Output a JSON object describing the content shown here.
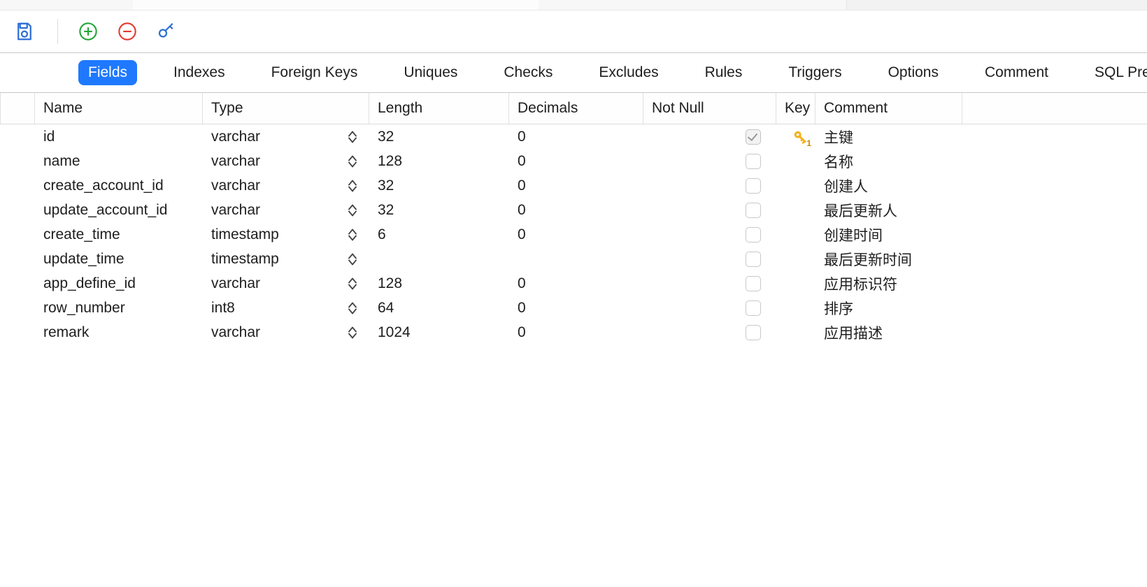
{
  "tabs": {
    "items": [
      {
        "id": "fields",
        "label": "Fields",
        "active": true
      },
      {
        "id": "indexes",
        "label": "Indexes",
        "active": false
      },
      {
        "id": "foreignkeys",
        "label": "Foreign Keys",
        "active": false
      },
      {
        "id": "uniques",
        "label": "Uniques",
        "active": false
      },
      {
        "id": "checks",
        "label": "Checks",
        "active": false
      },
      {
        "id": "excludes",
        "label": "Excludes",
        "active": false
      },
      {
        "id": "rules",
        "label": "Rules",
        "active": false
      },
      {
        "id": "triggers",
        "label": "Triggers",
        "active": false
      },
      {
        "id": "options",
        "label": "Options",
        "active": false
      },
      {
        "id": "comment",
        "label": "Comment",
        "active": false
      },
      {
        "id": "sqlpreview",
        "label": "SQL Preview",
        "active": false
      }
    ]
  },
  "headers": {
    "name": "Name",
    "type": "Type",
    "length": "Length",
    "decimals": "Decimals",
    "notnull": "Not Null",
    "key": "Key",
    "comment": "Comment"
  },
  "rows": [
    {
      "name": "id",
      "type": "varchar",
      "length": "32",
      "decimals": "0",
      "notnull": true,
      "key": true,
      "comment": "主键"
    },
    {
      "name": "name",
      "type": "varchar",
      "length": "128",
      "decimals": "0",
      "notnull": false,
      "key": false,
      "comment": "名称"
    },
    {
      "name": "create_account_id",
      "type": "varchar",
      "length": "32",
      "decimals": "0",
      "notnull": false,
      "key": false,
      "comment": "创建人"
    },
    {
      "name": "update_account_id",
      "type": "varchar",
      "length": "32",
      "decimals": "0",
      "notnull": false,
      "key": false,
      "comment": "最后更新人"
    },
    {
      "name": "create_time",
      "type": "timestamp",
      "length": "6",
      "decimals": "0",
      "notnull": false,
      "key": false,
      "comment": "创建时间"
    },
    {
      "name": "update_time",
      "type": "timestamp",
      "length": "",
      "decimals": "",
      "notnull": false,
      "key": false,
      "comment": "最后更新时间"
    },
    {
      "name": "app_define_id",
      "type": "varchar",
      "length": "128",
      "decimals": "0",
      "notnull": false,
      "key": false,
      "comment": "应用标识符"
    },
    {
      "name": "row_number",
      "type": "int8",
      "length": "64",
      "decimals": "0",
      "notnull": false,
      "key": false,
      "comment": "排序"
    },
    {
      "name": "remark",
      "type": "varchar",
      "length": "1024",
      "decimals": "0",
      "notnull": false,
      "key": false,
      "comment": "应用描述"
    }
  ],
  "key_sub": "1",
  "colors": {
    "accent": "#1f79ff",
    "add": "#22a53a",
    "remove": "#e23b2e",
    "save": "#2e6fd6",
    "key": "#f3b21b"
  }
}
